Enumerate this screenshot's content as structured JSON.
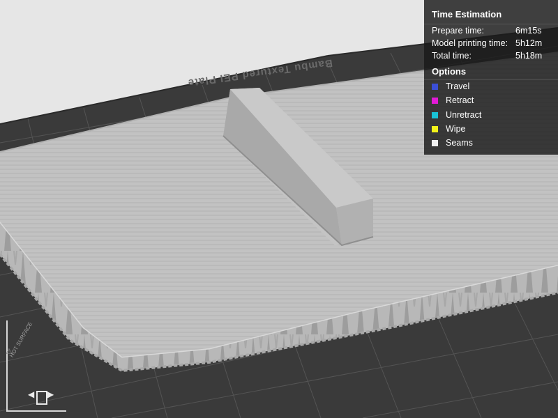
{
  "viewport": {
    "plate_label": "Bambu Textured PEI Plate",
    "hot_surface_label": "HOT SURFACE",
    "colors": {
      "background": "#e6e6e6",
      "plate": "#3a3a3a",
      "grid_line": "#555555",
      "model": "#bdbdbd"
    }
  },
  "time_estimation": {
    "title": "Time Estimation",
    "rows": [
      {
        "label": "Prepare time:",
        "value": "6m15s"
      },
      {
        "label": "Model printing time:",
        "value": "5h12m"
      },
      {
        "label": "Total time:",
        "value": "5h18m"
      }
    ]
  },
  "options": {
    "title": "Options",
    "items": [
      {
        "label": "Travel",
        "color": "#3b4fd6"
      },
      {
        "label": "Retract",
        "color": "#e21ad6"
      },
      {
        "label": "Unretract",
        "color": "#19c3d6"
      },
      {
        "label": "Wipe",
        "color": "#f2f21a"
      },
      {
        "label": "Seams",
        "color": "#f0f0f0"
      }
    ]
  }
}
